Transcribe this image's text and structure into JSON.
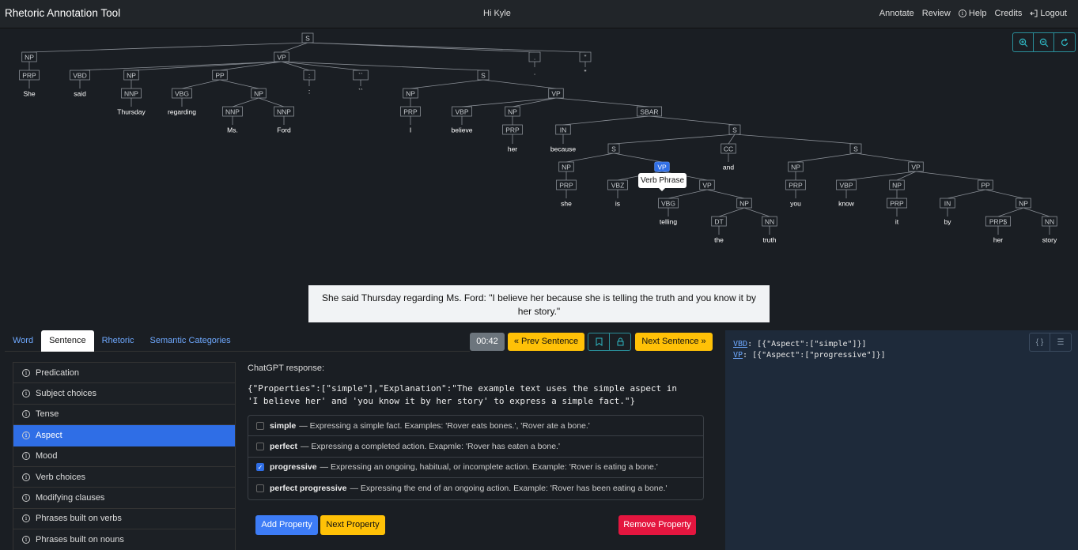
{
  "navbar": {
    "brand": "Rhetoric Annotation Tool",
    "greeting": "Hi Kyle",
    "links": [
      {
        "label": "Annotate",
        "icon": ""
      },
      {
        "label": "Review",
        "icon": ""
      },
      {
        "label": "Help",
        "icon": "info-circle-icon"
      },
      {
        "label": "Credits",
        "icon": ""
      },
      {
        "label": "Logout",
        "icon": "logout-icon"
      }
    ]
  },
  "tree": {
    "nodes": [
      {
        "label": "S"
      },
      {
        "label": "NP"
      },
      {
        "label": "VP"
      },
      {
        "label": "."
      },
      {
        "label": "\""
      },
      {
        "label": "PRP"
      },
      {
        "label": "VBD"
      },
      {
        "label": "NP"
      },
      {
        "label": "PP"
      },
      {
        "label": ":"
      },
      {
        "label": "``"
      },
      {
        "label": "S"
      },
      {
        "label": "NNP"
      },
      {
        "label": "VBG"
      },
      {
        "label": "NP"
      },
      {
        "label": "NNP"
      },
      {
        "label": "NNP"
      },
      {
        "label": "NP"
      },
      {
        "label": "VP"
      },
      {
        "label": "PRP"
      },
      {
        "label": "VBP"
      },
      {
        "label": "NP"
      },
      {
        "label": "SBAR"
      },
      {
        "label": "PRP"
      },
      {
        "label": "IN"
      },
      {
        "label": "S"
      },
      {
        "label": "S"
      },
      {
        "label": "CC"
      },
      {
        "label": "S"
      },
      {
        "label": "NP"
      },
      {
        "label": "VP"
      },
      {
        "label": "NP"
      },
      {
        "label": "VP"
      },
      {
        "label": "PRP"
      },
      {
        "label": "VBZ"
      },
      {
        "label": "VP"
      },
      {
        "label": "PRP"
      },
      {
        "label": "VBP"
      },
      {
        "label": "NP"
      },
      {
        "label": "PP"
      },
      {
        "label": "VBG"
      },
      {
        "label": "NP"
      },
      {
        "label": "PRP"
      },
      {
        "label": "IN"
      },
      {
        "label": "NP"
      },
      {
        "label": "DT"
      },
      {
        "label": "NN"
      },
      {
        "label": "PRP$"
      },
      {
        "label": "NN"
      }
    ],
    "words": [
      "She",
      "said",
      "Thursday",
      "regarding",
      "Ms.",
      "Ford",
      ":",
      "``",
      "I",
      "believe",
      "her",
      "because",
      "and",
      "she",
      "is",
      "you",
      "know",
      "it",
      "by",
      "telling",
      "the",
      "truth",
      "her",
      "story",
      ".",
      "\""
    ],
    "tooltip": "Verb Phrase"
  },
  "sentence": "She said Thursday regarding Ms. Ford: \"I believe her because she is telling the truth and you know it by her story.\"",
  "tabs": [
    "Word",
    "Sentence",
    "Rhetoric",
    "Semantic Categories"
  ],
  "controls": {
    "timer": "00:42",
    "prev": "Prev Sentence",
    "next": "Next Sentence"
  },
  "properties": [
    "Predication",
    "Subject choices",
    "Tense",
    "Aspect",
    "Mood",
    "Verb choices",
    "Modifying clauses",
    "Phrases built on verbs",
    "Phrases built on nouns"
  ],
  "gpt": {
    "label": "ChatGPT response:",
    "response": "{\"Properties\":[\"simple\"],\"Explanation\":\"The example text uses the simple aspect in 'I believe her' and 'you know it by her story' to express a simple fact.\"}"
  },
  "options": [
    {
      "name": "simple",
      "desc": "— Expressing a simple fact. Examples: 'Rover eats bones.', 'Rover ate a bone.'",
      "checked": false
    },
    {
      "name": "perfect",
      "desc": "— Expressing a completed action. Exapmle: 'Rover has eaten a bone.'",
      "checked": false
    },
    {
      "name": "progressive",
      "desc": "— Expressing an ongoing, habitual, or incomplete action. Example: 'Rover is eating a bone.'",
      "checked": true
    },
    {
      "name": "perfect progressive",
      "desc": "— Expressing the end of an ongoing action. Example: 'Rover has been eating a bone.'",
      "checked": false
    }
  ],
  "buttons": {
    "add": "Add Property",
    "next_prop": "Next Property",
    "remove": "Remove Property"
  },
  "json_panel": [
    {
      "key": "VBD",
      "value": ": [{\"Aspect\":[\"simple\"]}]"
    },
    {
      "key": "VP",
      "value": ": [{\"Aspect\":[\"progressive\"]}]"
    }
  ]
}
